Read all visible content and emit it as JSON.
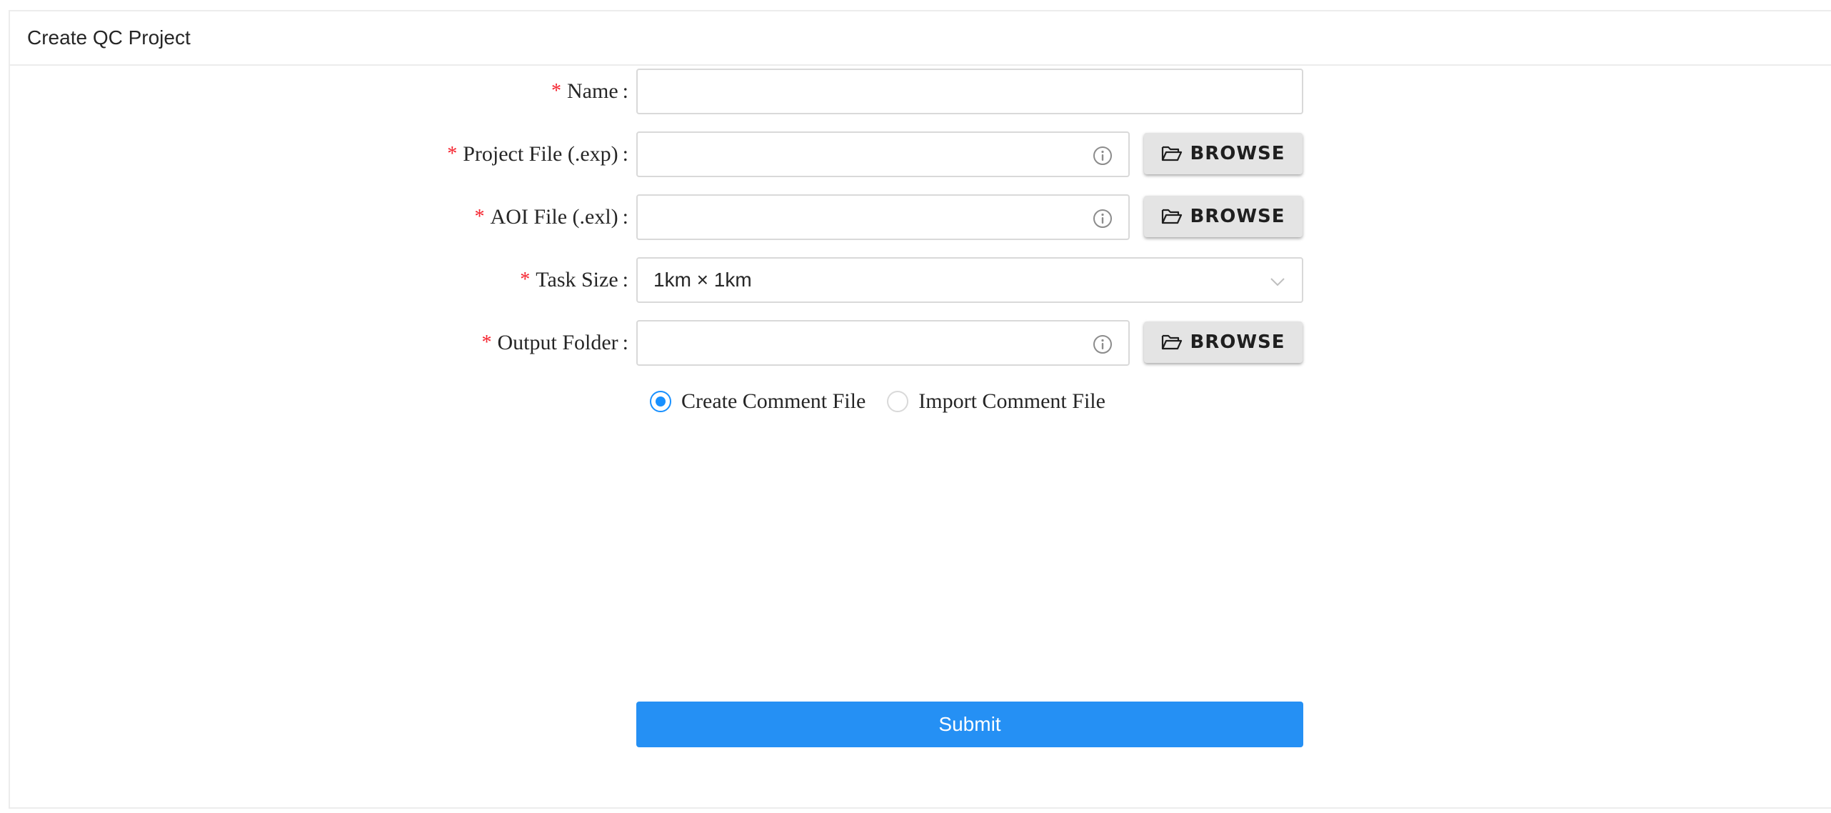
{
  "card": {
    "title": "Create QC Project"
  },
  "form": {
    "name": {
      "required_mark": "*",
      "label": "Name",
      "colon": ":",
      "value": "",
      "placeholder": ""
    },
    "project_file": {
      "required_mark": "*",
      "label": "Project File (.exp)",
      "colon": ":",
      "value": "",
      "icon": "info-circle-icon",
      "browse_label": "BROWSE",
      "browse_icon": "folder-open-icon"
    },
    "aoi_file": {
      "required_mark": "*",
      "label": "AOI File (.exl)",
      "colon": ":",
      "value": "",
      "icon": "info-circle-icon",
      "browse_label": "BROWSE",
      "browse_icon": "folder-open-icon"
    },
    "task_size": {
      "required_mark": "*",
      "label": "Task Size",
      "colon": ":",
      "selected": "1km × 1km",
      "icon": "chevron-down-icon"
    },
    "output_folder": {
      "required_mark": "*",
      "label": "Output Folder",
      "colon": ":",
      "value": "",
      "icon": "info-circle-icon",
      "browse_label": "BROWSE",
      "browse_icon": "folder-open-icon"
    },
    "comment_mode": {
      "options": [
        {
          "label": "Create Comment File",
          "checked": true
        },
        {
          "label": "Import Comment File",
          "checked": false
        }
      ]
    },
    "submit_label": "Submit"
  },
  "colors": {
    "primary": "#2590f4",
    "radio_checked": "#1890ff",
    "required": "#f5222d",
    "browse_bg": "#e4e4e4",
    "border": "#d9d9d9"
  }
}
